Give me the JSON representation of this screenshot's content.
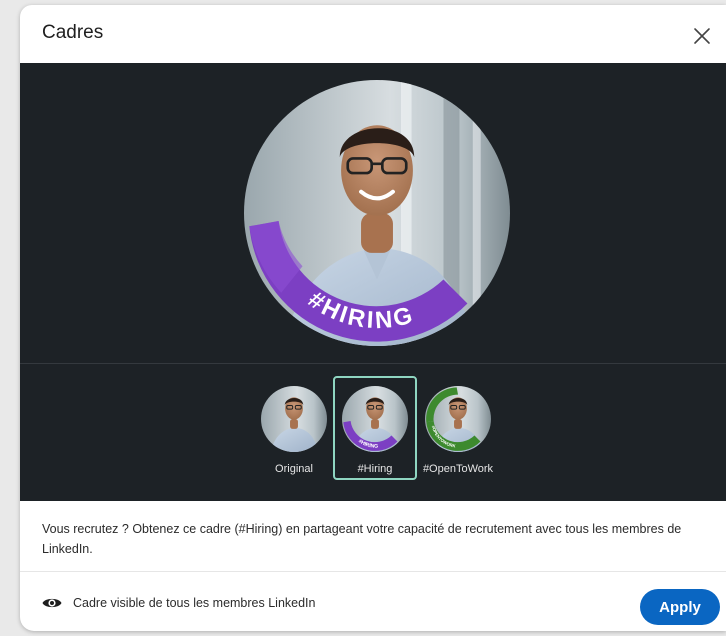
{
  "dialog": {
    "title": "Cadres",
    "close_icon": "close-icon"
  },
  "preview": {
    "frame_text": "#HIRING",
    "frame_color": "#7c3fc3"
  },
  "frames": {
    "options": [
      {
        "label": "Original",
        "selected": false
      },
      {
        "label": "#Hiring",
        "selected": true,
        "badge": "#HIRING"
      },
      {
        "label": "#OpenToWork",
        "selected": false,
        "badge": "#OPENTOWORK"
      }
    ],
    "hiring_color": "#7c3fc3",
    "opentowork_color": "#3d8a2e",
    "selected_border_color": "#8fd6c1"
  },
  "description": {
    "text": "Vous recrutez ? Obtenez ce cadre (#Hiring) en partageant votre capacité de recrutement avec tous les membres de LinkedIn."
  },
  "footer": {
    "visibility_icon": "eye-icon",
    "visibility_text": "Cadre visible de tous les membres LinkedIn",
    "apply_label": "Apply",
    "accent_color": "#0a66c2"
  }
}
